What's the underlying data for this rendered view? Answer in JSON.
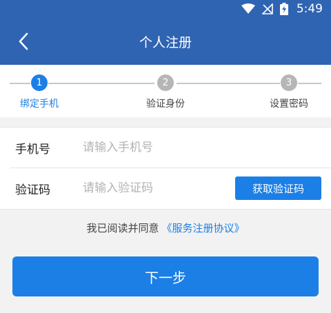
{
  "status_bar": {
    "time": "5:49",
    "icons": [
      "wifi-icon",
      "no-signal-icon",
      "battery-charging-icon"
    ]
  },
  "header": {
    "title": "个人注册",
    "back_icon": "chevron-left-icon"
  },
  "steps": [
    {
      "number": "1",
      "label": "绑定手机",
      "active": true
    },
    {
      "number": "2",
      "label": "验证身份",
      "active": false
    },
    {
      "number": "3",
      "label": "设置密码",
      "active": false
    }
  ],
  "form": {
    "phone": {
      "label": "手机号",
      "placeholder": "请输入手机号",
      "value": ""
    },
    "code": {
      "label": "验证码",
      "placeholder": "请输入验证码",
      "value": "",
      "button_label": "获取验证码"
    }
  },
  "agreement": {
    "text": "我已阅读并同意",
    "link": "《服务注册协议》"
  },
  "next_button": "下一步",
  "colors": {
    "header_bg": "#2f64b2",
    "accent": "#1b7fe6",
    "inactive_step": "#b6b6b6",
    "page_bg": "#f2f2f2"
  }
}
